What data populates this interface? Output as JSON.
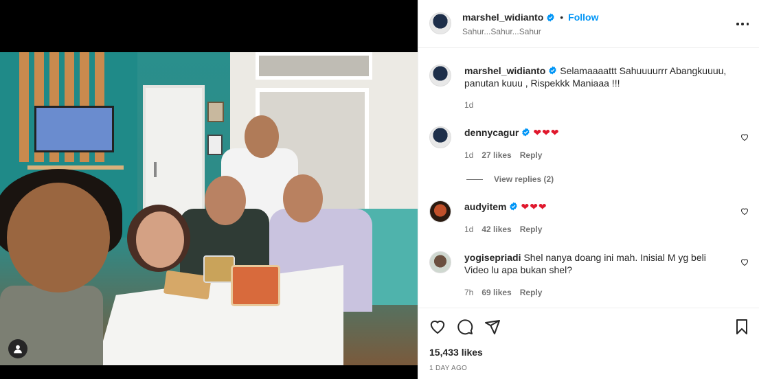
{
  "post": {
    "username": "marshel_widianto",
    "follow_label": "Follow",
    "subtitle": "Sahur...Sahur...Sahur",
    "more_icon": "more-horizontal-icon"
  },
  "caption": {
    "username": "marshel_widianto",
    "text": "Selamaaaattt Sahuuuurrr Abangkuuuu, panutan kuuu , Rispekkk Maniaaa !!!",
    "time": "1d"
  },
  "comments": [
    {
      "username": "dennycagur",
      "verified": true,
      "text": "❤❤❤",
      "time": "1d",
      "likes": "27 likes",
      "reply_label": "Reply"
    },
    {
      "username": "audyitem",
      "verified": true,
      "text": "❤❤❤",
      "time": "1d",
      "likes": "42 likes",
      "reply_label": "Reply"
    },
    {
      "username": "yogisepriadi",
      "verified": false,
      "text": "Shel nanya doang ini mah. Inisial M yg beli Video lu apa bukan shel?",
      "time": "7h",
      "likes": "69 likes",
      "reply_label": "Reply"
    }
  ],
  "view_replies_label": "View replies (2)",
  "footer": {
    "likes": "15,433 likes",
    "time": "1 DAY AGO"
  },
  "colors": {
    "accent": "#0095f6",
    "verified": "#0095f6",
    "heart": "#e0182d",
    "secondary_text": "#737373"
  }
}
